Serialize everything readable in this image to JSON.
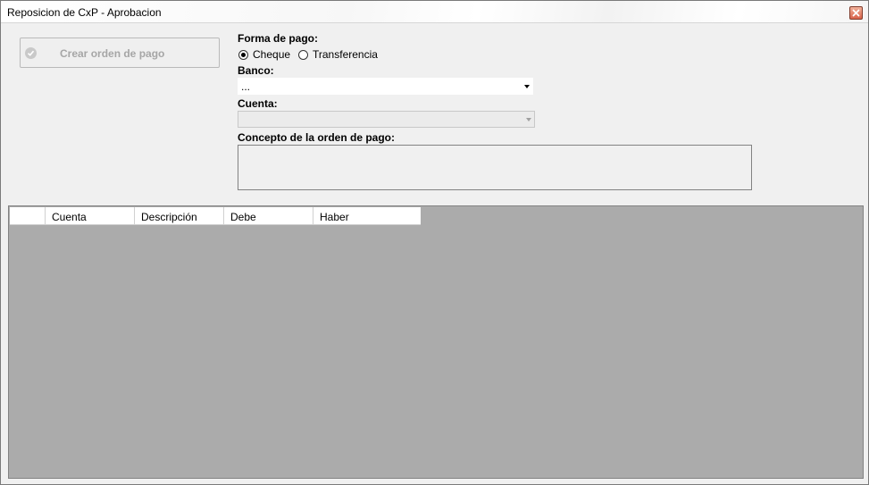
{
  "window": {
    "title": "Reposicion de CxP - Aprobacion"
  },
  "toolbar": {
    "crear_label": "Crear orden de pago"
  },
  "form": {
    "forma_pago_label": "Forma de pago:",
    "forma_pago_options": [
      "Cheque",
      "Transferencia"
    ],
    "forma_pago_selected": "Cheque",
    "banco_label": "Banco:",
    "banco_value": "...",
    "cuenta_label": "Cuenta:",
    "cuenta_value": "",
    "concepto_label": "Concepto de la orden de pago:",
    "concepto_value": ""
  },
  "grid": {
    "columns": [
      "Cuenta",
      "Descripción",
      "Debe",
      "Haber"
    ],
    "rows": []
  }
}
